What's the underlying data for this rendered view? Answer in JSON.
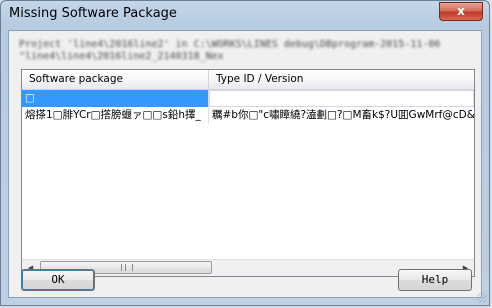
{
  "window": {
    "title": "Missing Software Package",
    "close_label": "x"
  },
  "message": {
    "line1": "Project 'line4\\2016line2' in C:\\WORKS\\LINES debug\\DBprogram-2015-11-06",
    "line2": "\"line4\\line4\\2016line2_2140318_Nex"
  },
  "table": {
    "columns": [
      "Software package",
      "Type ID / Version"
    ],
    "rows": [
      {
        "package": "□",
        "type_version": ""
      },
      {
        "package": "熔搽1□腓YCr□撘膀蝘ァ□□s鉛h擇_",
        "type_version": "糲#b你□\"c嘯瞕繞?溘劃□?□M畜k$?U囬GwMrf@cD&"
      }
    ]
  },
  "buttons": {
    "ok_label": "OK",
    "help_label": "Help"
  },
  "icons": {
    "scroll_left": "scroll-left-arrow-icon",
    "scroll_right": "scroll-right-arrow-icon",
    "grip": "scrollbar-grip-icon"
  },
  "colors": {
    "selection": "#3399ff",
    "close_button": "#c0392b"
  }
}
